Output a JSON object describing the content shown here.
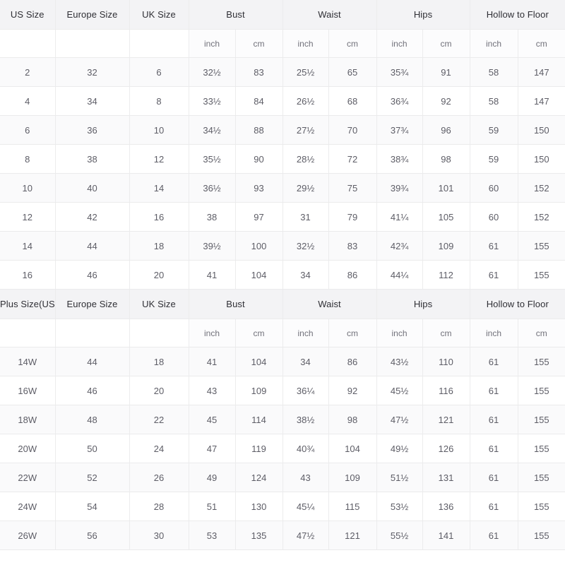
{
  "tables": [
    {
      "id": "standard-size-table",
      "headers": [
        "US Size",
        "Europe Size",
        "UK Size",
        "Bust",
        "Waist",
        "Hips",
        "Hollow to Floor"
      ],
      "unit_row": [
        "",
        "",
        "",
        "inch",
        "cm",
        "inch",
        "cm",
        "inch",
        "cm",
        "inch",
        "cm"
      ],
      "rows": [
        {
          "us": "2",
          "eu": "32",
          "uk": "6",
          "bust_in": "32½",
          "bust_cm": "83",
          "waist_in": "25½",
          "waist_cm": "65",
          "hips_in": "35¾",
          "hips_cm": "91",
          "hollow_in": "58",
          "hollow_cm": "147"
        },
        {
          "us": "4",
          "eu": "34",
          "uk": "8",
          "bust_in": "33½",
          "bust_cm": "84",
          "waist_in": "26½",
          "waist_cm": "68",
          "hips_in": "36¾",
          "hips_cm": "92",
          "hollow_in": "58",
          "hollow_cm": "147"
        },
        {
          "us": "6",
          "eu": "36",
          "uk": "10",
          "bust_in": "34½",
          "bust_cm": "88",
          "waist_in": "27½",
          "waist_cm": "70",
          "hips_in": "37¾",
          "hips_cm": "96",
          "hollow_in": "59",
          "hollow_cm": "150"
        },
        {
          "us": "8",
          "eu": "38",
          "uk": "12",
          "bust_in": "35½",
          "bust_cm": "90",
          "waist_in": "28½",
          "waist_cm": "72",
          "hips_in": "38¾",
          "hips_cm": "98",
          "hollow_in": "59",
          "hollow_cm": "150"
        },
        {
          "us": "10",
          "eu": "40",
          "uk": "14",
          "bust_in": "36½",
          "bust_cm": "93",
          "waist_in": "29½",
          "waist_cm": "75",
          "hips_in": "39¾",
          "hips_cm": "101",
          "hollow_in": "60",
          "hollow_cm": "152"
        },
        {
          "us": "12",
          "eu": "42",
          "uk": "16",
          "bust_in": "38",
          "bust_cm": "97",
          "waist_in": "31",
          "waist_cm": "79",
          "hips_in": "41¼",
          "hips_cm": "105",
          "hollow_in": "60",
          "hollow_cm": "152"
        },
        {
          "us": "14",
          "eu": "44",
          "uk": "18",
          "bust_in": "39½",
          "bust_cm": "100",
          "waist_in": "32½",
          "waist_cm": "83",
          "hips_in": "42¾",
          "hips_cm": "109",
          "hollow_in": "61",
          "hollow_cm": "155"
        },
        {
          "us": "16",
          "eu": "46",
          "uk": "20",
          "bust_in": "41",
          "bust_cm": "104",
          "waist_in": "34",
          "waist_cm": "86",
          "hips_in": "44¼",
          "hips_cm": "112",
          "hollow_in": "61",
          "hollow_cm": "155"
        }
      ]
    },
    {
      "id": "plus-size-table",
      "headers": [
        "Plus Size(US)",
        "Europe Size",
        "UK Size",
        "Bust",
        "Waist",
        "Hips",
        "Hollow to Floor"
      ],
      "unit_row": [
        "",
        "",
        "",
        "inch",
        "cm",
        "inch",
        "cm",
        "inch",
        "cm",
        "inch",
        "cm"
      ],
      "rows": [
        {
          "us": "14W",
          "eu": "44",
          "uk": "18",
          "bust_in": "41",
          "bust_cm": "104",
          "waist_in": "34",
          "waist_cm": "86",
          "hips_in": "43½",
          "hips_cm": "110",
          "hollow_in": "61",
          "hollow_cm": "155"
        },
        {
          "us": "16W",
          "eu": "46",
          "uk": "20",
          "bust_in": "43",
          "bust_cm": "109",
          "waist_in": "36¼",
          "waist_cm": "92",
          "hips_in": "45½",
          "hips_cm": "116",
          "hollow_in": "61",
          "hollow_cm": "155"
        },
        {
          "us": "18W",
          "eu": "48",
          "uk": "22",
          "bust_in": "45",
          "bust_cm": "114",
          "waist_in": "38½",
          "waist_cm": "98",
          "hips_in": "47½",
          "hips_cm": "121",
          "hollow_in": "61",
          "hollow_cm": "155"
        },
        {
          "us": "20W",
          "eu": "50",
          "uk": "24",
          "bust_in": "47",
          "bust_cm": "119",
          "waist_in": "40¾",
          "waist_cm": "104",
          "hips_in": "49½",
          "hips_cm": "126",
          "hollow_in": "61",
          "hollow_cm": "155"
        },
        {
          "us": "22W",
          "eu": "52",
          "uk": "26",
          "bust_in": "49",
          "bust_cm": "124",
          "waist_in": "43",
          "waist_cm": "109",
          "hips_in": "51½",
          "hips_cm": "131",
          "hollow_in": "61",
          "hollow_cm": "155"
        },
        {
          "us": "24W",
          "eu": "54",
          "uk": "28",
          "bust_in": "51",
          "bust_cm": "130",
          "waist_in": "45¼",
          "waist_cm": "115",
          "hips_in": "53½",
          "hips_cm": "136",
          "hollow_in": "61",
          "hollow_cm": "155"
        },
        {
          "us": "26W",
          "eu": "56",
          "uk": "30",
          "bust_in": "53",
          "bust_cm": "135",
          "waist_in": "47½",
          "waist_cm": "121",
          "hips_in": "55½",
          "hips_cm": "141",
          "hollow_in": "61",
          "hollow_cm": "155"
        }
      ]
    }
  ]
}
